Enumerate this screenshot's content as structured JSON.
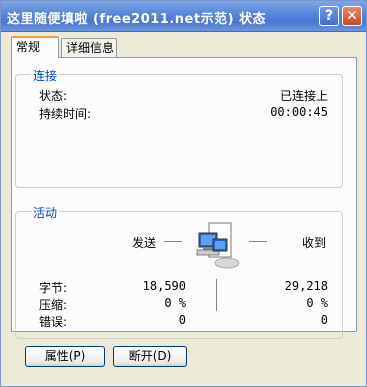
{
  "window": {
    "title": "这里随便填啦 (free2011.net示范) 状态",
    "help": "?",
    "close": "✕"
  },
  "tabs": [
    {
      "label": "常规"
    },
    {
      "label": "详细信息"
    }
  ],
  "connection": {
    "group_label": "连接",
    "status_label": "状态:",
    "status_value": "已连接上",
    "duration_label": "持续时间:",
    "duration_value": "00:00:45"
  },
  "activity": {
    "group_label": "活动",
    "sent_label": "发送",
    "received_label": "收到",
    "rows": [
      {
        "label": "字节:",
        "sent": "18,590",
        "received": "29,218"
      },
      {
        "label": "压缩:",
        "sent": "0 %",
        "received": "0 %"
      },
      {
        "label": "错误:",
        "sent": "0",
        "received": "0"
      }
    ]
  },
  "buttons": {
    "properties": "属性(P)",
    "disconnect": "断开(D)"
  },
  "colors": {
    "titlebar": "#4a78cf",
    "group_label": "#0046d5",
    "background": "#ece9d8"
  }
}
